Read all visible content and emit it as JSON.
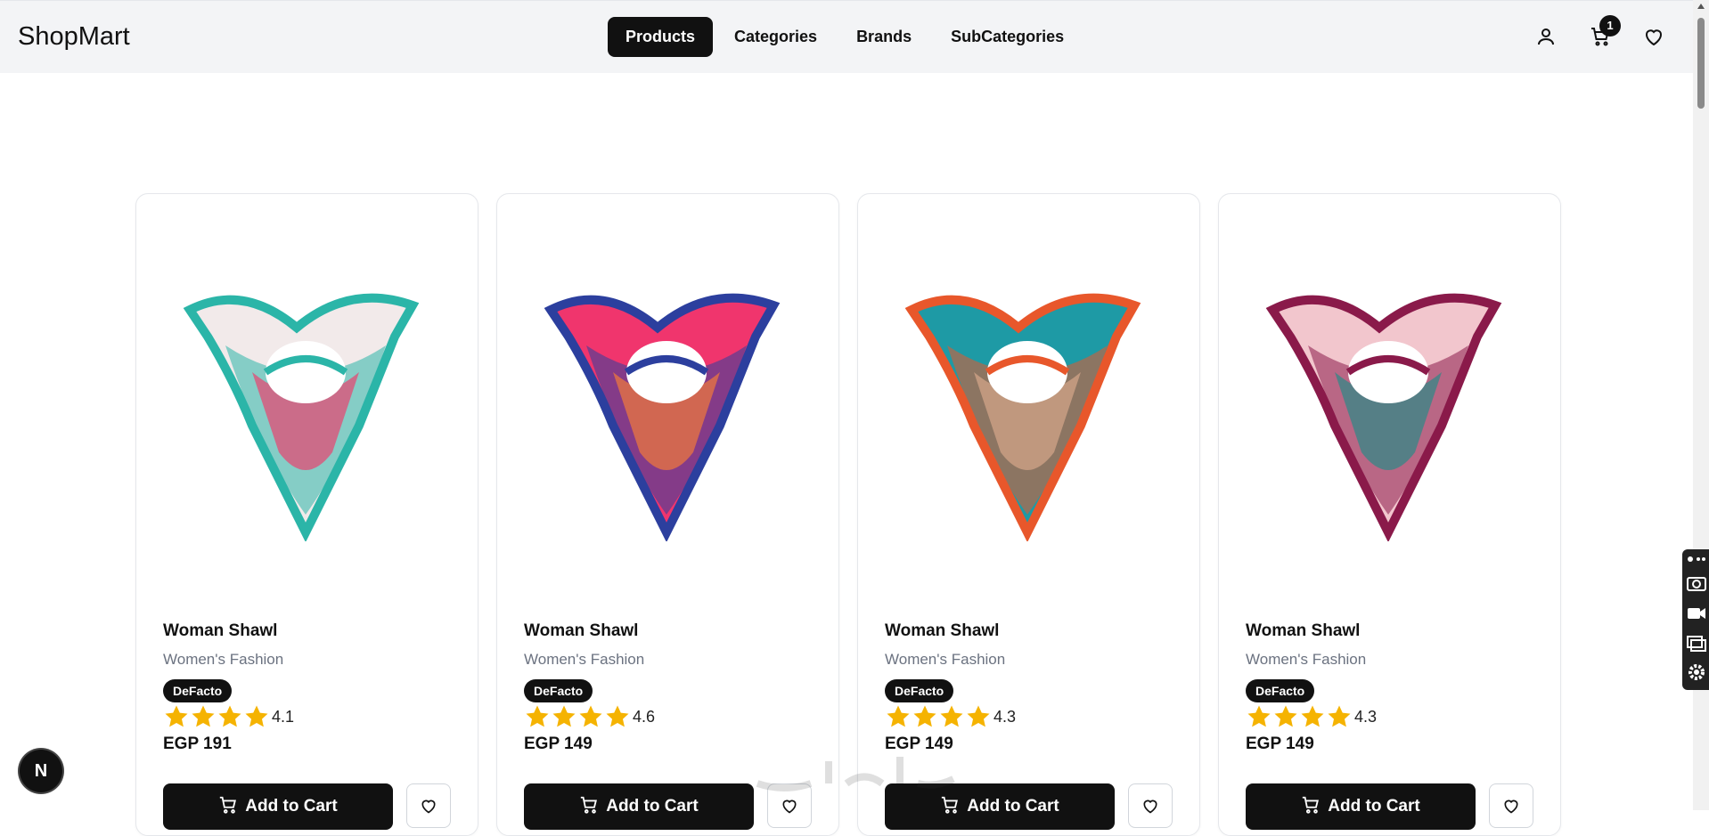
{
  "header": {
    "logo": "ShopMart",
    "nav": [
      "Products",
      "Categories",
      "Brands",
      "SubCategories"
    ],
    "active_nav": "Products",
    "cart_count": "1",
    "icons": [
      "user-icon",
      "cart-icon",
      "heart-icon"
    ]
  },
  "products": [
    {
      "title": "Woman Shawl",
      "category": "Women's Fashion",
      "brand": "DeFacto",
      "rating": "4.1",
      "price": "EGP 191",
      "add_label": "Add to Cart",
      "colors": [
        "#2bb5a8",
        "#f2eaea",
        "#e8436f"
      ]
    },
    {
      "title": "Woman Shawl",
      "category": "Women's Fashion",
      "brand": "DeFacto",
      "rating": "4.6",
      "price": "EGP 149",
      "add_label": "Add to Cart",
      "colors": [
        "#2c3f9e",
        "#f0356d",
        "#f27a3a"
      ]
    },
    {
      "title": "Woman Shawl",
      "category": "Women's Fashion",
      "brand": "DeFacto",
      "rating": "4.3",
      "price": "EGP 149",
      "add_label": "Add to Cart",
      "colors": [
        "#e8572b",
        "#1e9aa5",
        "#d5a78a"
      ]
    },
    {
      "title": "Woman Shawl",
      "category": "Women's Fashion",
      "brand": "DeFacto",
      "rating": "4.3",
      "price": "EGP 149",
      "add_label": "Add to Cart",
      "colors": [
        "#8a1a4a",
        "#f2c6cd",
        "#2b8a86"
      ]
    }
  ],
  "star_color": "#f5b301",
  "dev_badge": "N"
}
